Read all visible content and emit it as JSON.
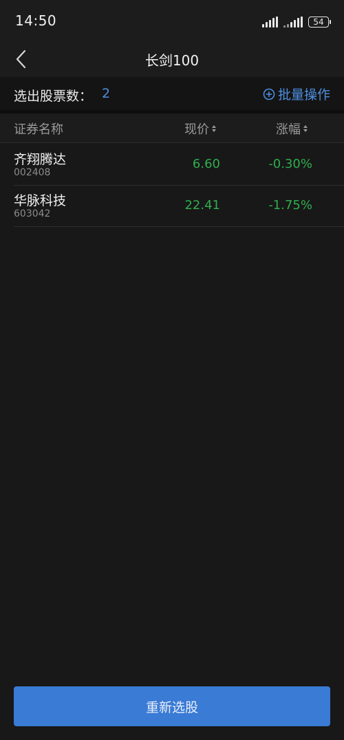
{
  "status_bar": {
    "time": "14:50",
    "battery": "54",
    "icons": [
      "cellular-signal-icon",
      "wifi-signal-icon",
      "battery-icon"
    ]
  },
  "header": {
    "title": "长剑100",
    "back_icon": "chevron-left-icon"
  },
  "summary": {
    "label": "选出股票数：",
    "count": "2",
    "batch_label": "批量操作",
    "batch_icon": "plus-circle-icon"
  },
  "table": {
    "columns": {
      "name": "证券名称",
      "price": "现价",
      "change": "涨幅"
    },
    "rows": [
      {
        "name": "齐翔腾达",
        "code": "002408",
        "price": "6.60",
        "change": "-0.30%"
      },
      {
        "name": "华脉科技",
        "code": "603042",
        "price": "22.41",
        "change": "-1.75%"
      }
    ]
  },
  "footer": {
    "button_label": "重新选股"
  },
  "colors": {
    "background": "#181818",
    "accent": "#4d8fe0",
    "button": "#3a7bd5",
    "down": "#2fae4e"
  }
}
